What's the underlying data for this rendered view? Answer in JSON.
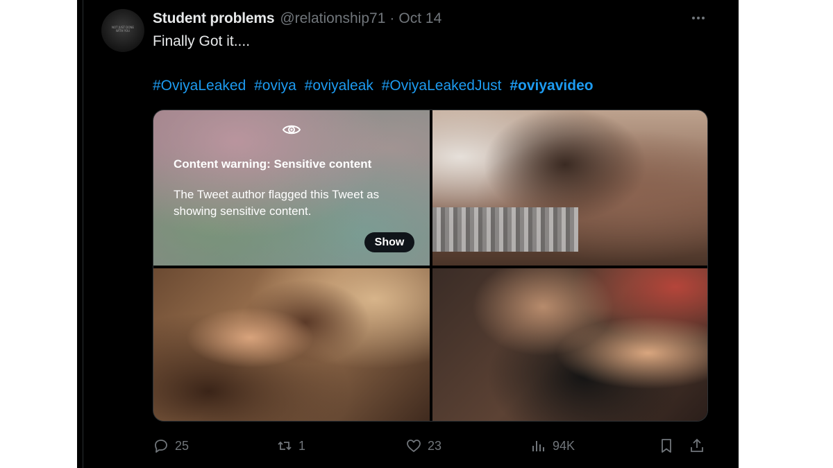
{
  "author": {
    "name": "Student problems",
    "handle": "@relationship71",
    "separator": "·",
    "date": "Oct 14",
    "avatar_text": "NOT JUST DONE WITH YOU",
    "more_icon": "more-dots-icon"
  },
  "tweet": {
    "text": "Finally Got it....",
    "hashtags": [
      {
        "text": "#OviyaLeaked",
        "bold": false
      },
      {
        "text": "#oviya",
        "bold": false
      },
      {
        "text": "#oviyaleak",
        "bold": false
      },
      {
        "text": "#OviyaLeakedJust",
        "bold": false
      },
      {
        "text": "#oviyavideo",
        "bold": true
      }
    ]
  },
  "media": {
    "warning_icon": "eye-icon",
    "warning_title": "Content warning: Sensitive content",
    "warning_body": "The Tweet author flagged this Tweet as showing sensitive content.",
    "show_label": "Show"
  },
  "actions": {
    "replies": "25",
    "reposts": "1",
    "likes": "23",
    "views": "94K"
  },
  "colors": {
    "background": "#000000",
    "text": "#e7e9ea",
    "muted": "#71767b",
    "link": "#1d9bf0"
  }
}
